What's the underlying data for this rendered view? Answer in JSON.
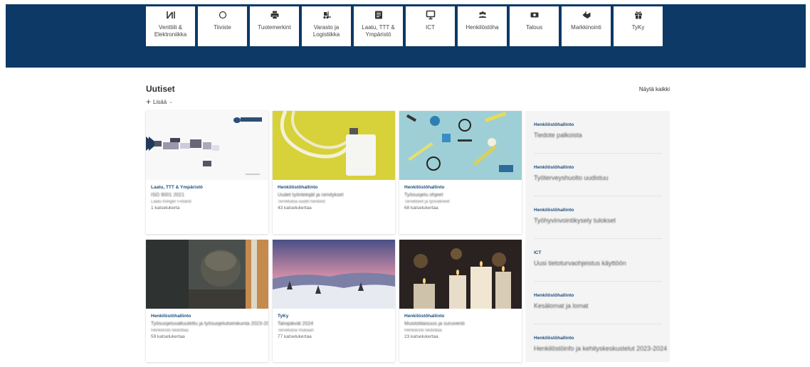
{
  "quicklinks": [
    {
      "label": "Venttiili & Elektroniikka",
      "icon": "valve-icon"
    },
    {
      "label": "Tiiviste",
      "icon": "ring-icon"
    },
    {
      "label": "Tuotemerkint",
      "icon": "printer-icon"
    },
    {
      "label": "Varasto ja Logistiikka",
      "icon": "forklift-icon"
    },
    {
      "label": "Laatu, TTT & Ympäristö",
      "icon": "document-icon"
    },
    {
      "label": "ICT",
      "icon": "monitor-icon"
    },
    {
      "label": "Henkilöstöha",
      "icon": "people-icon"
    },
    {
      "label": "Talous",
      "icon": "money-icon"
    },
    {
      "label": "Markkinointi",
      "icon": "handshake-icon"
    },
    {
      "label": "TyKy",
      "icon": "gift-icon"
    }
  ],
  "news": {
    "title": "Uutiset",
    "see_all": "Näytä kaikki",
    "add": "Lisää",
    "cards": [
      {
        "category": "Laatu, TTT & Ympäristö",
        "title": "ISO 9001 2021",
        "subtitle": "Laatu Klinger Finland",
        "views": "1 katselukerta",
        "image": "klinger-doc"
      },
      {
        "category": "Henkilöstöhallinto",
        "title": "Uudet työntekijät ja nimitykset",
        "subtitle": "Tervetuloa uudet henkilöt",
        "views": "43 katselukertaa",
        "image": "lanyard"
      },
      {
        "category": "Henkilöstöhallinto",
        "title": "Työsuojelu ohjeet",
        "subtitle": "Tarvikkeet ja työvälineet",
        "views": "68 katselukertaa",
        "image": "tools"
      },
      {
        "category": "Henkilöstöhallinto",
        "title": "Työsuojeluvaltuutettu ja työsuojelutoimikunta 2023-2024",
        "subtitle": "Henkilöstö tiedottaa",
        "views": "59 katselukertaa",
        "image": "worker"
      },
      {
        "category": "TyKy",
        "title": "Talvipäivät 2024",
        "subtitle": "Tervetuloa mukaan",
        "views": "77 katselukertaa",
        "image": "winter"
      },
      {
        "category": "Henkilöstöhallinto",
        "title": "Muistotilaisuus ja suruviesti",
        "subtitle": "Henkilöstö tiedottaa",
        "views": "23 katselukertaa",
        "image": "candles"
      }
    ]
  },
  "sidebar": [
    {
      "category": "Henkilöstöhallinto",
      "title": "Tiedote palkoista"
    },
    {
      "category": "Henkilöstöhallinto",
      "title": "Työterveyshuolto uudistuu"
    },
    {
      "category": "Henkilöstöhallinto",
      "title": "Työhyvinvointikysely tulokset"
    },
    {
      "category": "ICT",
      "title": "Uusi tietoturvaohjeistus käyttöön"
    },
    {
      "category": "Henkilöstöhallinto",
      "title": "Kesälomat ja lomat"
    },
    {
      "category": "Henkilöstöhallinto",
      "title": "Henkilöstöinfo ja kehityskeskustelut 2023-2024"
    }
  ],
  "colors": {
    "band": "#0c3966",
    "category": "#1b4f7e",
    "side_bg": "#f4f4f4"
  }
}
